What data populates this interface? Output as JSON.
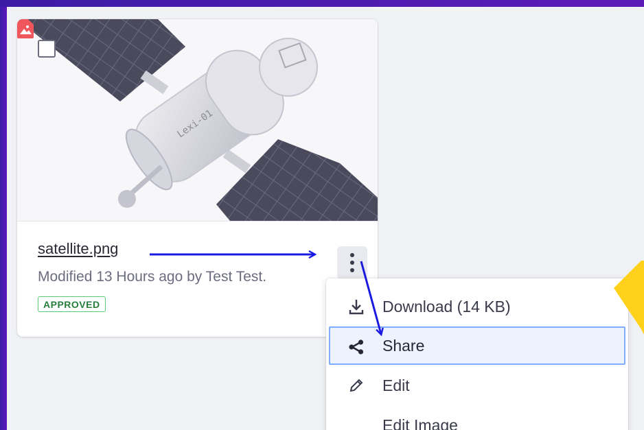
{
  "card": {
    "filename": "satellite.png",
    "modified": "Modified 13 Hours ago by Test Test.",
    "status_badge": "APPROVED",
    "thumbnail_label": "Lexi-01"
  },
  "menu": {
    "items": [
      {
        "label": "Download (14 KB)",
        "icon": "download-icon"
      },
      {
        "label": "Share",
        "icon": "share-icon",
        "highlighted": true
      },
      {
        "label": "Edit",
        "icon": "pencil-icon"
      },
      {
        "label": "Edit Image",
        "icon": ""
      }
    ]
  },
  "colors": {
    "accent_purple": "#4b1bb0",
    "annotation_arrow": "#1a1ae0",
    "badge_green": "#287d3c",
    "filetype_red": "#f0575d",
    "highlight_border": "#80acff",
    "yellow_shape": "#ffd11a"
  }
}
